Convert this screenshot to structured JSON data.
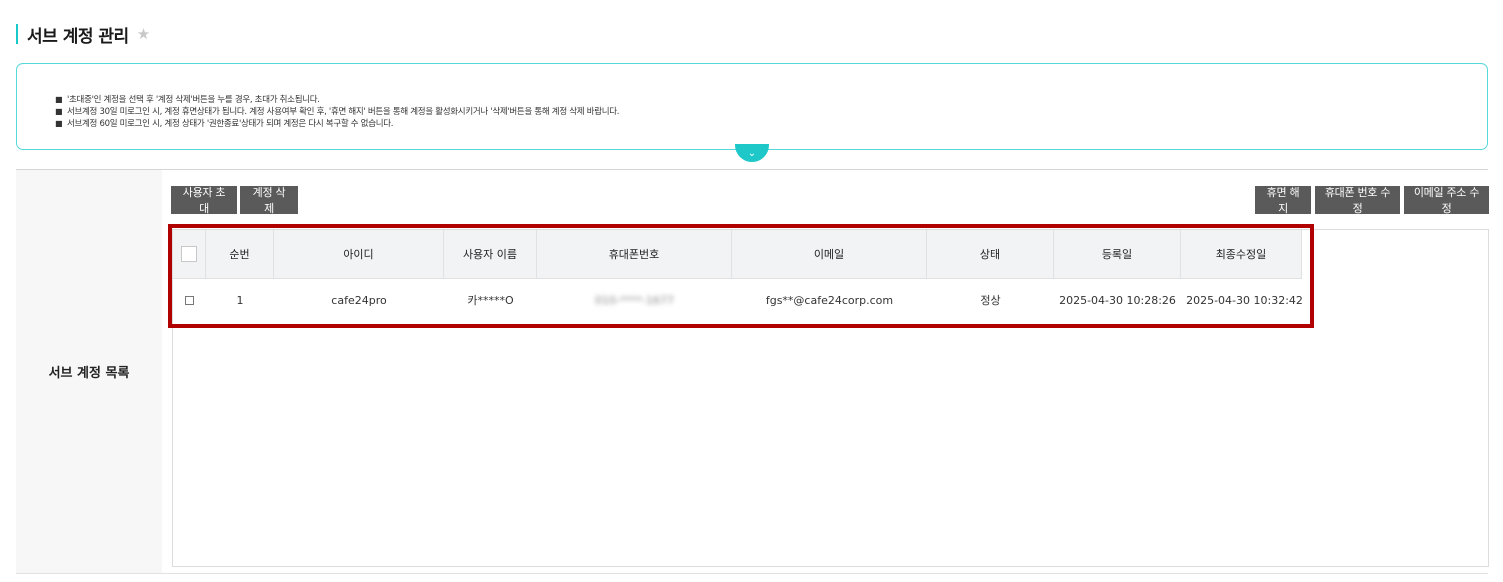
{
  "header": {
    "title": "서브 계정 관리",
    "favorite_icon": "★"
  },
  "notice": {
    "items": [
      "'초대중'인 계정을 선택 후 '계정 삭제'버튼을 누를 경우, 초대가 취소됩니다.",
      "서브계정 30일 미로그인 시, 계정 휴면상태가 됩니다. 계정 사용여부 확인 후, '휴면 해지' 버튼을 통해 계정을 활성화시키거나 '삭제'버튼을 통해 계정 삭제 바랍니다.",
      "서브계정 60일 미로그인 시, 계정 상태가 '권한종료'상태가 되며 계정은 다시 복구할 수 없습니다."
    ],
    "bullet": "■",
    "toggle_icon": "⌄"
  },
  "section": {
    "label": "서브 계정 목록"
  },
  "toolbar": {
    "invite_label": "사용자 초대",
    "delete_label": "계정 삭제",
    "release_dormant_label": "휴면 해지",
    "edit_phone_label": "휴대폰 번호 수정",
    "edit_email_label": "이메일 주소 수정"
  },
  "table": {
    "columns": [
      "순번",
      "아이디",
      "사용자 이름",
      "휴대폰번호",
      "이메일",
      "상태",
      "등록일",
      "최종수정일"
    ],
    "rows": [
      {
        "no": "1",
        "id": "cafe24pro",
        "name": "카*****O",
        "phone": "010-****-1677",
        "email": "fgs**@cafe24corp.com",
        "status": "정상",
        "registered": "2025-04-30 10:28:26",
        "modified": "2025-04-30 10:32:42"
      }
    ]
  },
  "colors": {
    "accent": "#19c8c8",
    "button": "#5a5a5a",
    "highlight": "#b00000"
  }
}
